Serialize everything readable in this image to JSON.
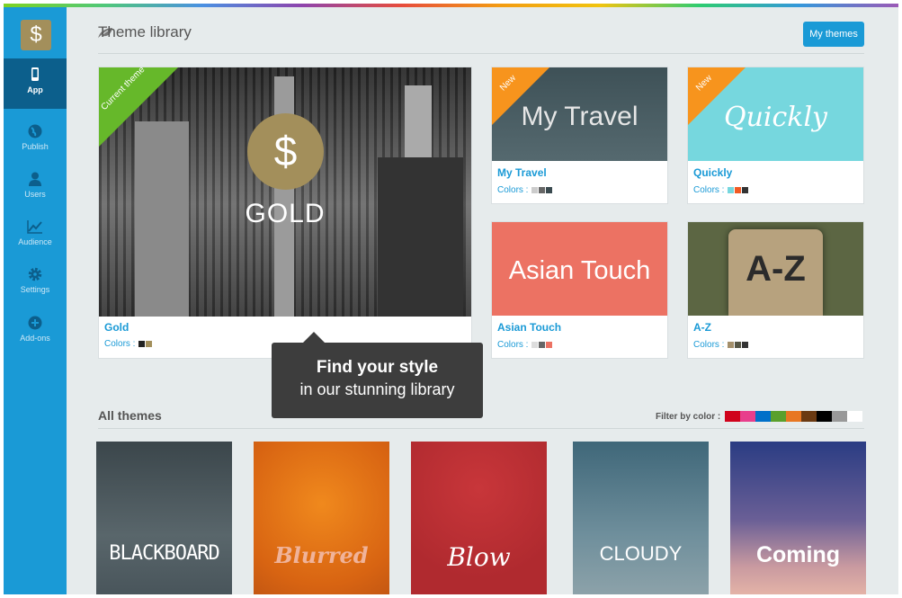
{
  "sidebar": {
    "items": [
      {
        "label": "App",
        "icon": "phone-icon",
        "active": true
      },
      {
        "label": "Publish",
        "icon": "globe-icon"
      },
      {
        "label": "Users",
        "icon": "user-icon"
      },
      {
        "label": "Audience",
        "icon": "chart-icon"
      },
      {
        "label": "Settings",
        "icon": "gear-icon"
      },
      {
        "label": "Add-ons",
        "icon": "plus-circle-icon"
      }
    ]
  },
  "header": {
    "title": "Theme library",
    "my_themes": "My themes"
  },
  "featured": [
    {
      "name": "Gold",
      "colors_label": "Colors :",
      "ribbon": "Current theme",
      "image_text": "GOLD",
      "swatches": [
        "#222222",
        "#a38f5b"
      ]
    },
    {
      "name": "My Travel",
      "colors_label": "Colors :",
      "ribbon": "New",
      "image_text": "My Travel",
      "swatches": [
        "#cccccc",
        "#666666",
        "#3a4a4f"
      ]
    },
    {
      "name": "Quickly",
      "colors_label": "Colors :",
      "ribbon": "New",
      "image_text": "Quickly",
      "swatches": [
        "#76d7de",
        "#f15a24",
        "#333333"
      ]
    },
    {
      "name": "Asian Touch",
      "colors_label": "Colors :",
      "image_text": "Asian Touch",
      "swatches": [
        "#dddddd",
        "#666666",
        "#ec7263"
      ]
    },
    {
      "name": "A-Z",
      "colors_label": "Colors :",
      "image_text": "A-Z",
      "swatches": [
        "#a38f6b",
        "#555544",
        "#333333"
      ]
    }
  ],
  "tooltip": {
    "line1": "Find your style",
    "line2": "in our stunning library"
  },
  "all_themes": {
    "title": "All themes",
    "filter_label": "Filter by color :",
    "filter_colors": [
      "#d0021b",
      "#e83e8c",
      "#0070c9",
      "#5aa02c",
      "#e87722",
      "#6b3a12",
      "#000000",
      "#999999",
      "#ffffff"
    ],
    "tiles": [
      {
        "name": "BLACKBOARD"
      },
      {
        "name": "Blurred"
      },
      {
        "name": "Blow"
      },
      {
        "name": "CLOUDY"
      },
      {
        "name": "Coming"
      }
    ]
  }
}
